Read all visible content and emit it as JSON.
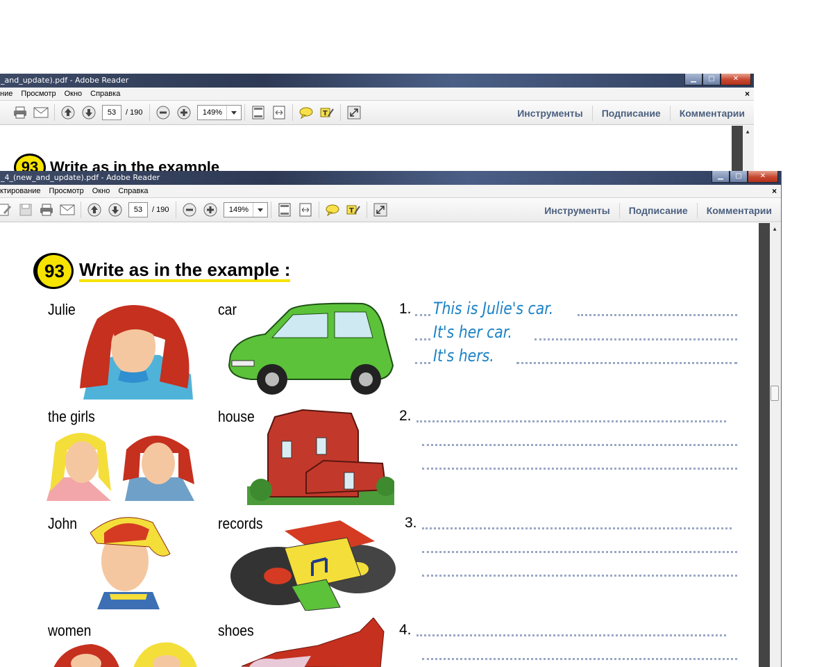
{
  "back_window": {
    "title": "_and_update).pdf - Adobe Reader",
    "menu": [
      "ние",
      "Просмотр",
      "Окно",
      "Справка"
    ],
    "page_current": "53",
    "page_total": "/ 190",
    "zoom": "149%",
    "tools": [
      "Инструменты",
      "Подписание",
      "Комментарии"
    ],
    "peek_number": "93",
    "peek_title": "Write as in the example"
  },
  "front_window": {
    "title": "_4_(new_and_update).pdf - Adobe Reader",
    "menu": [
      "ктирование",
      "Просмотр",
      "Окно",
      "Справка"
    ],
    "page_current": "53",
    "page_total": "/ 190",
    "zoom": "149%",
    "tools": [
      "Инструменты",
      "Подписание",
      "Комментарии"
    ]
  },
  "exercise": {
    "number": "93",
    "title": "Write as in the example :",
    "rows": [
      {
        "person": "Julie",
        "object": "car",
        "num": "1.",
        "answers": [
          "This is Julie's car.",
          "It's her car.",
          "It's hers."
        ]
      },
      {
        "person": "the girls",
        "object": "house",
        "num": "2."
      },
      {
        "person": "John",
        "object": "records",
        "num": "3."
      },
      {
        "person": "women",
        "object": "shoes",
        "num": "4."
      }
    ]
  },
  "colors": {
    "accent_yellow": "#f6e300",
    "answer_blue": "#1c82c5",
    "tool_link": "#4a5f7f"
  }
}
